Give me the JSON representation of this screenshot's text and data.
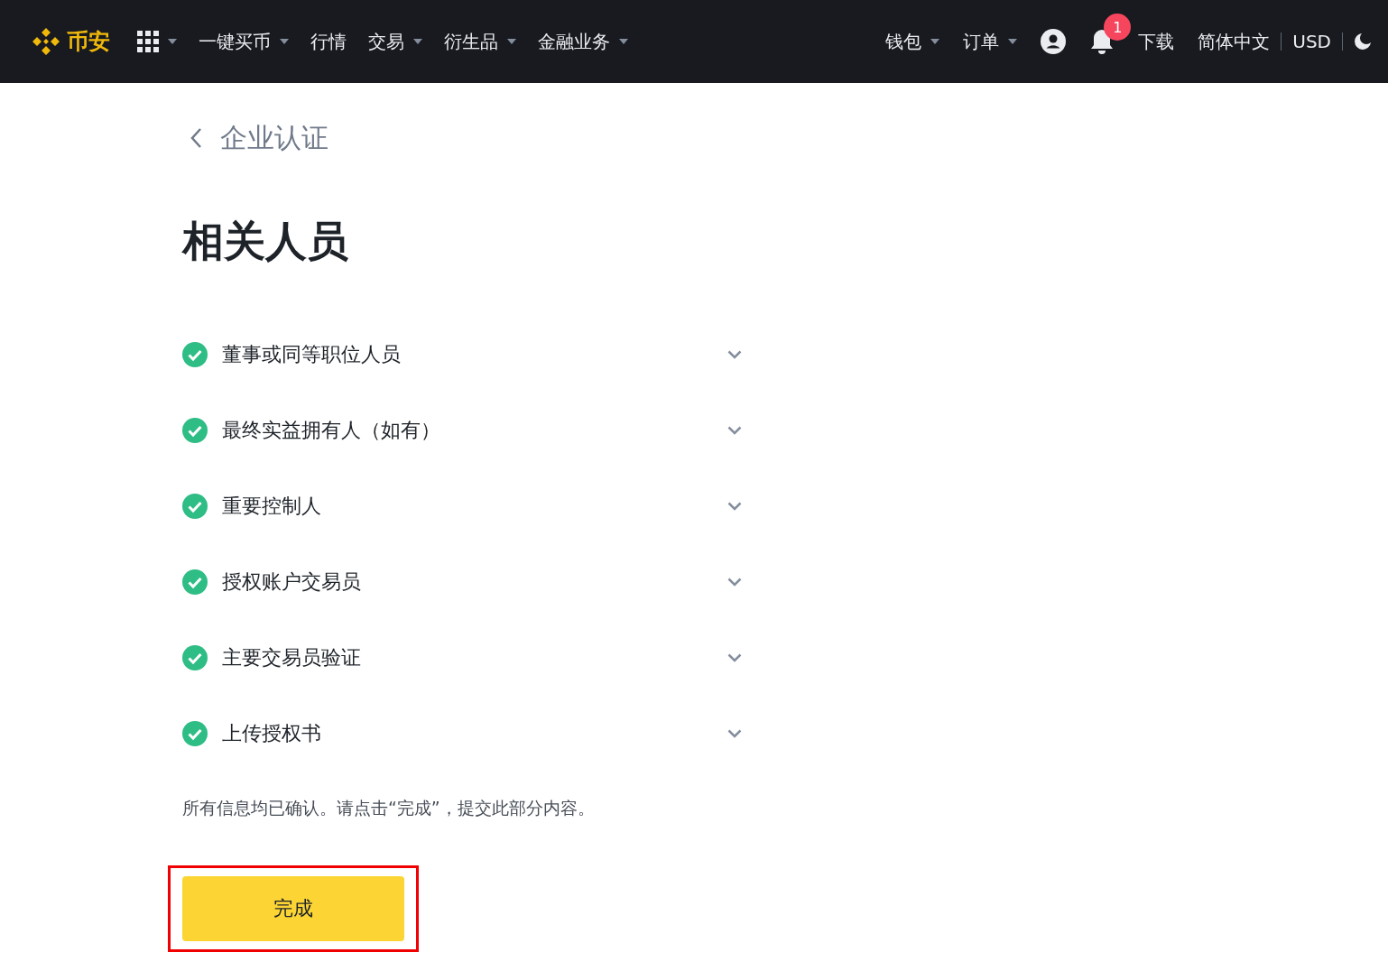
{
  "header": {
    "logo_text": "币安",
    "nav_left": [
      {
        "kind": "apps",
        "dropdown": true
      },
      {
        "kind": "text",
        "label": "一键买币",
        "dropdown": true
      },
      {
        "kind": "text",
        "label": "行情",
        "dropdown": false
      },
      {
        "kind": "text",
        "label": "交易",
        "dropdown": true
      },
      {
        "kind": "text",
        "label": "衍生品",
        "dropdown": true
      },
      {
        "kind": "text",
        "label": "金融业务",
        "dropdown": true
      }
    ],
    "nav_right": [
      {
        "kind": "text",
        "label": "钱包",
        "dropdown": true
      },
      {
        "kind": "text",
        "label": "订单",
        "dropdown": true
      },
      {
        "kind": "account"
      },
      {
        "kind": "notifications",
        "badge": "1"
      },
      {
        "kind": "text",
        "label": "下载",
        "dropdown": false
      },
      {
        "kind": "text",
        "label": "简体中文",
        "dropdown": false
      },
      {
        "kind": "divider"
      },
      {
        "kind": "text",
        "label": "USD",
        "dropdown": false
      },
      {
        "kind": "divider"
      },
      {
        "kind": "theme"
      }
    ]
  },
  "back_title": "企业认证",
  "heading": "相关人员",
  "sections": [
    {
      "label": "董事或同等职位人员",
      "completed": true,
      "expanded": false
    },
    {
      "label": "最终实益拥有人（如有）",
      "completed": true,
      "expanded": false
    },
    {
      "label": "重要控制人",
      "completed": true,
      "expanded": false
    },
    {
      "label": "授权账户交易员",
      "completed": true,
      "expanded": false
    },
    {
      "label": "主要交易员验证",
      "completed": true,
      "expanded": false
    },
    {
      "label": "上传授权书",
      "completed": true,
      "expanded": false
    }
  ],
  "note": "所有信息均已确认。请点击“完成”，提交此部分内容。",
  "submit_button": {
    "label": "完成",
    "highlighted": true
  }
}
